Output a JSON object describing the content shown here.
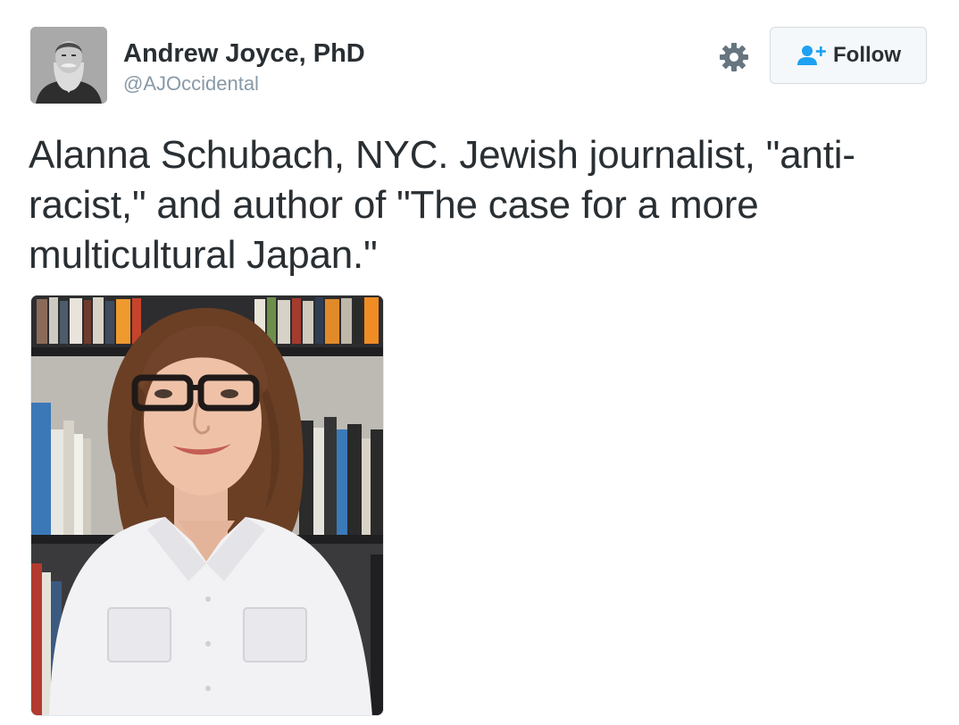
{
  "author": {
    "name": "Andrew Joyce, PhD",
    "handle": "@AJOccidental",
    "avatar_icon": "portrait-avatar-icon"
  },
  "actions": {
    "settings_icon": "gear-icon",
    "follow_label": "Follow",
    "follow_icon": "add-user-icon",
    "follow_color": "#1da1f2"
  },
  "tweet": {
    "text_lines": [
      "Alanna Schubach, NYC. Jewish journalist, \"anti-",
      "racist,\" and author of \"The case for a more",
      "multicultural Japan.\""
    ]
  },
  "media": {
    "type": "photo"
  },
  "colors": {
    "text": "#292f33",
    "secondary": "#8899a6",
    "button_bg": "#f5f8fa",
    "button_border": "#d6dbdf"
  }
}
